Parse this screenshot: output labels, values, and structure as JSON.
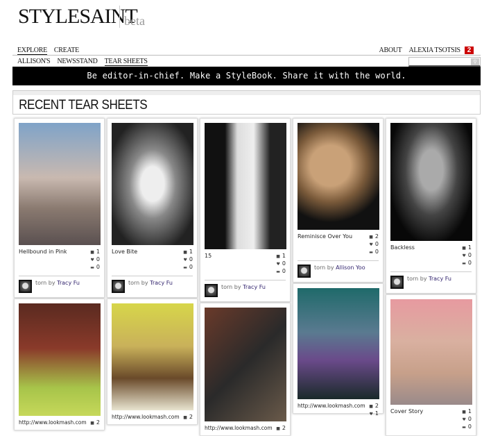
{
  "logo": {
    "brand": "STYLESAINT",
    "tag": "beta"
  },
  "nav_primary": [
    {
      "label": "EXPLORE"
    },
    {
      "label": "CREATE"
    }
  ],
  "nav_right": {
    "about": "ABOUT",
    "user": "ALEXIA TSOTSIS",
    "notifications": "2"
  },
  "nav_secondary": [
    {
      "label": "ALLISON'S"
    },
    {
      "label": "NEWSSTAND"
    },
    {
      "label": "TEAR SHEETS"
    }
  ],
  "search": {
    "placeholder": "",
    "icon": "search-icon"
  },
  "banner": "Be editor-in-chief.  Make a StyleBook.  Share it with the world.",
  "heading": "RECENT TEAR SHEETS",
  "torn_by": "torn by",
  "cards": [
    {
      "title": "Hellbound in Pink",
      "tears": "1",
      "likes": "0",
      "comments": "0",
      "author": "Tracy Fu"
    },
    {
      "title": "Love Bite",
      "tears": "1",
      "likes": "0",
      "comments": "0",
      "author": "Tracy Fu"
    },
    {
      "title": "15",
      "tears": "1",
      "likes": "0",
      "comments": "0",
      "author": "Tracy Fu"
    },
    {
      "title": "Reminisce Over You",
      "tears": "2",
      "likes": "0",
      "comments": "0",
      "author": "Allison Yoo"
    },
    {
      "title": "Backless",
      "tears": "1",
      "likes": "0",
      "comments": "0",
      "author": "Tracy Fu"
    },
    {
      "title": "http://www.lookmash.com",
      "tears": "2"
    },
    {
      "title": "http://www.lookmash.com",
      "tears": "2"
    },
    {
      "title": "http://www.lookmash.com",
      "tears": "2"
    },
    {
      "title": "http://www.lookmash.com",
      "tears": "2",
      "likes": "1"
    },
    {
      "title": "Cover Story",
      "tears": "1",
      "likes": "0",
      "comments": "0"
    }
  ]
}
